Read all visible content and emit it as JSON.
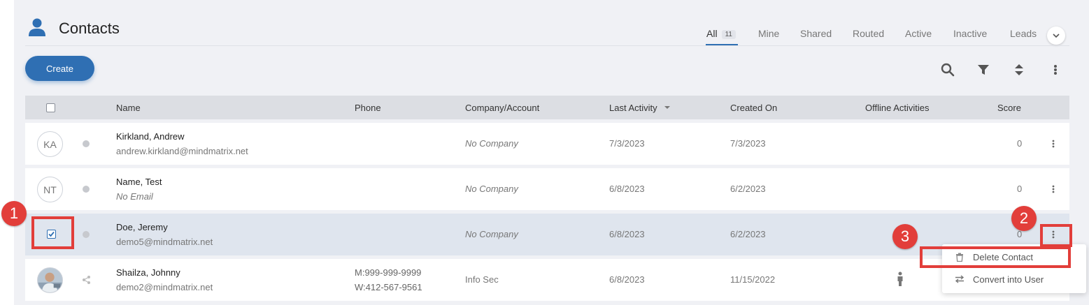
{
  "page": {
    "title": "Contacts"
  },
  "tabs": [
    {
      "label": "All",
      "badge": "11"
    },
    {
      "label": "Mine"
    },
    {
      "label": "Shared"
    },
    {
      "label": "Routed"
    },
    {
      "label": "Active"
    },
    {
      "label": "Inactive"
    },
    {
      "label": "Leads"
    }
  ],
  "toolbar": {
    "create_label": "Create",
    "icons": [
      "search-icon",
      "filter-icon",
      "sort-icon",
      "more-vertical-icon"
    ]
  },
  "table": {
    "columns": [
      "Name",
      "Phone",
      "Company/Account",
      "Last Activity",
      "Created On",
      "Offline Activities",
      "Score"
    ],
    "sorted_column": "Last Activity",
    "rows": [
      {
        "initials": "KA",
        "name": "Kirkland, Andrew",
        "email": "andrew.kirkland@mindmatrix.net",
        "phone_mobile": "",
        "phone_work": "",
        "company": "No Company",
        "last_activity": "7/3/2023",
        "created_on": "7/3/2023",
        "score": "0",
        "selected": false
      },
      {
        "initials": "NT",
        "name": "Name, Test",
        "email": "No Email",
        "phone_mobile": "",
        "phone_work": "",
        "company": "No Company",
        "last_activity": "6/8/2023",
        "created_on": "6/2/2023",
        "score": "0",
        "selected": false
      },
      {
        "initials": "",
        "name": "Doe, Jeremy",
        "email": "demo5@mindmatrix.net",
        "phone_mobile": "",
        "phone_work": "",
        "company": "No Company",
        "last_activity": "6/8/2023",
        "created_on": "6/2/2023",
        "score": "0",
        "selected": true
      },
      {
        "initials": "",
        "name": "Shailza, Johnny",
        "email": "demo2@mindmatrix.net",
        "phone_mobile": "M:999-999-9999",
        "phone_work": "W:412-567-9561",
        "company": "Info Sec",
        "last_activity": "6/8/2023",
        "created_on": "11/15/2022",
        "score": "",
        "selected": false
      }
    ]
  },
  "row_menu": {
    "items": [
      {
        "label": "Delete Contact",
        "icon": "trash-icon"
      },
      {
        "label": "Convert into User",
        "icon": "swap-arrows-icon"
      }
    ]
  },
  "annotations": {
    "callouts": [
      "1",
      "2",
      "3"
    ],
    "color": "#e23e3a"
  },
  "colors": {
    "accent": "#2f6fb3",
    "header_bg": "#dcdee3",
    "selected_row": "#dfe5ee",
    "page_bg": "#f0f1f5"
  }
}
